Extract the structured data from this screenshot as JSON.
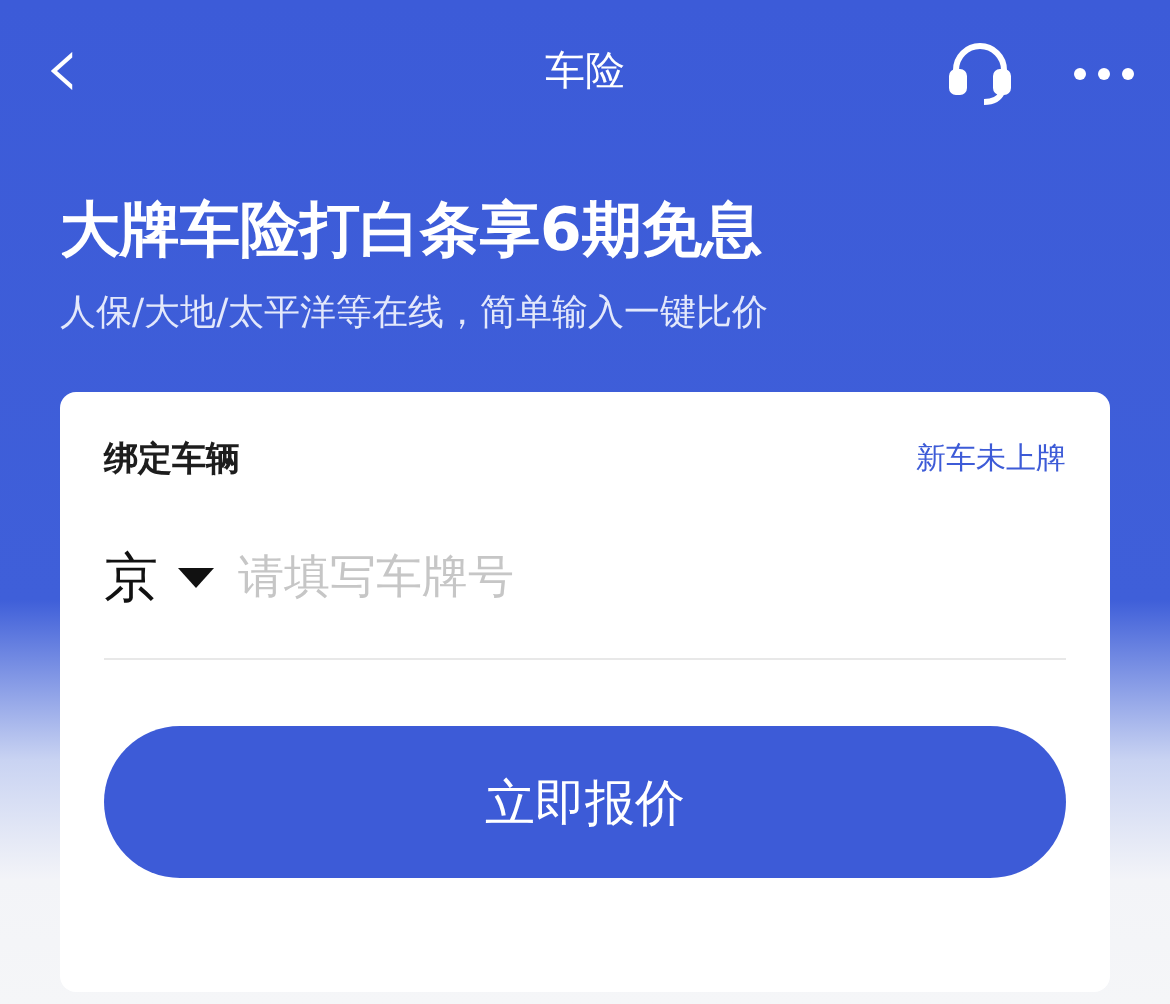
{
  "nav_bar": {
    "back_icon": "‹",
    "title": "车险"
  },
  "banner": {
    "headline": "大牌车险打白条享6期免息",
    "subtitle": "人保/大地/太平洋等在线，简单输入一键比价"
  },
  "card": {
    "title": "绑定车辆",
    "link": "新车未上牌",
    "province": "京",
    "plate_field": {
      "placeholder": "请填写车牌号"
    },
    "button": "立即报价"
  }
}
